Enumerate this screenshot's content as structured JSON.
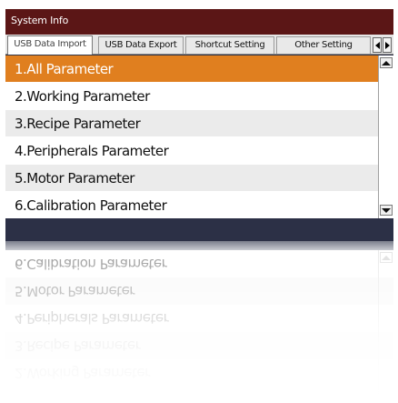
{
  "window": {
    "title": "System Info"
  },
  "tabs": [
    {
      "label": "USB Data Import",
      "active": true
    },
    {
      "label": "USB Data Export",
      "active": false
    },
    {
      "label": "Shortcut Setting",
      "active": false
    },
    {
      "label": "Other Setting",
      "active": false
    }
  ],
  "parameters": [
    {
      "label": "1.All Parameter",
      "selected": true
    },
    {
      "label": "2.Working Parameter",
      "selected": false
    },
    {
      "label": "3.Recipe Parameter",
      "selected": false
    },
    {
      "label": "4.Peripherals Parameter",
      "selected": false
    },
    {
      "label": "5.Motor Parameter",
      "selected": false
    },
    {
      "label": "6.Calibration Parameter",
      "selected": false
    }
  ],
  "colors": {
    "title_bar": "#5b1616",
    "selection": "#e07f1f",
    "frame": "#2d3146"
  },
  "icons": {
    "tab_scroll_left": "triangle-left",
    "tab_scroll_right": "triangle-right",
    "scroll_up": "triangle-up",
    "scroll_down": "triangle-down"
  }
}
